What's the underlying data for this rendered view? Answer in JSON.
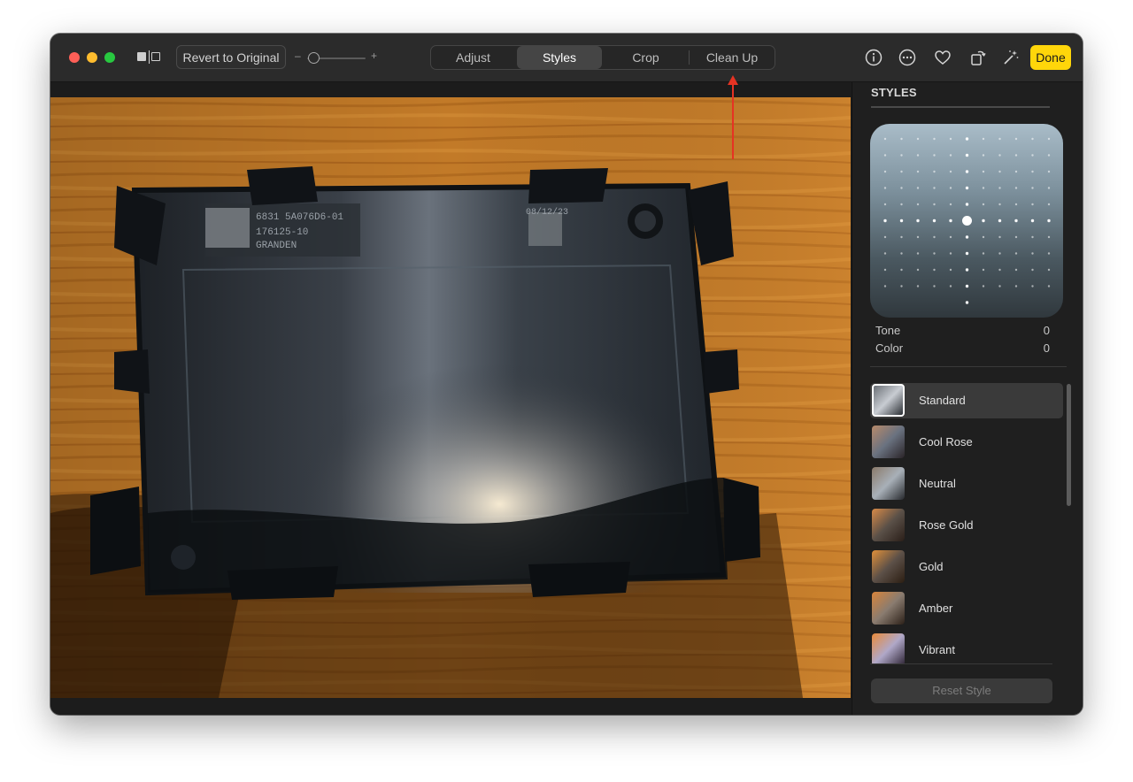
{
  "toolbar": {
    "revert_label": "Revert to Original",
    "slider_minus": "–",
    "slider_plus": "+",
    "tabs": [
      {
        "label": "Adjust",
        "active": false
      },
      {
        "label": "Styles",
        "active": true
      },
      {
        "label": "Crop",
        "active": false
      },
      {
        "label": "Clean Up",
        "active": false
      }
    ],
    "done_label": "Done",
    "icons": [
      "compare-icon",
      "info-icon",
      "more-icon",
      "heart-icon",
      "rotate-icon",
      "auto-enhance-icon"
    ]
  },
  "photo": {
    "description_icon": "photo-image",
    "labels": [
      "6831 5A076D6-01",
      "176125-10",
      "GRANDEN",
      "08/12/23"
    ]
  },
  "sidebar": {
    "title": "STYLES",
    "tone_label": "Tone",
    "tone_value": "0",
    "color_label": "Color",
    "color_value": "0",
    "styles": [
      {
        "name": "Standard",
        "selected": true
      },
      {
        "name": "Cool Rose",
        "selected": false
      },
      {
        "name": "Neutral",
        "selected": false
      },
      {
        "name": "Rose Gold",
        "selected": false
      },
      {
        "name": "Gold",
        "selected": false
      },
      {
        "name": "Amber",
        "selected": false
      },
      {
        "name": "Vibrant",
        "selected": false
      }
    ],
    "reset_label": "Reset Style"
  },
  "colors": {
    "accent_done": "#ffd60a",
    "annotation_arrow": "#e53323",
    "traffic_red": "#fe5f57",
    "traffic_yellow": "#febc2e",
    "traffic_green": "#28c840"
  }
}
